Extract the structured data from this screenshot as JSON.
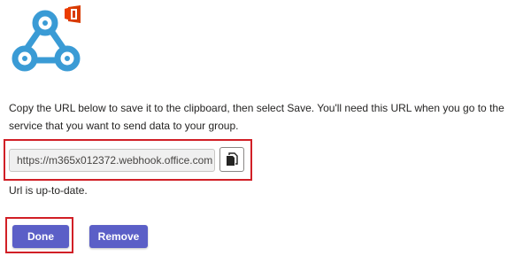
{
  "logo": {
    "icon": "webhook-icon",
    "badge_icon": "office-logo-icon",
    "badge_color": "#d83b01",
    "webhook_color": "#3a9bd5"
  },
  "instructions": {
    "text": "Copy the URL below to save it to the clipboard, then select Save. You'll need this URL when you go to the service that you want to send data to your group."
  },
  "url_field": {
    "value": "https://m365x012372.webhook.office.com"
  },
  "copy_button": {
    "icon": "copy-icon"
  },
  "status": {
    "text": "Url is up-to-date."
  },
  "buttons": {
    "done_label": "Done",
    "remove_label": "Remove",
    "color": "#5b5fc7"
  },
  "highlight_color": "#d11f26"
}
